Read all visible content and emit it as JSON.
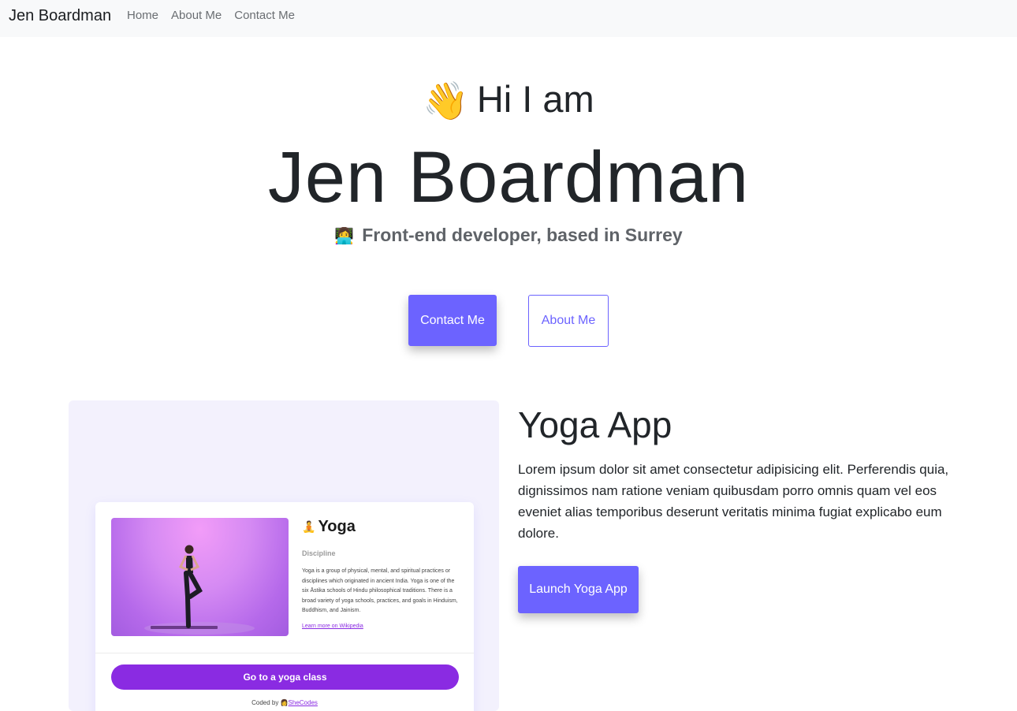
{
  "navbar": {
    "brand": "Jen Boardman",
    "links": [
      "Home",
      "About Me",
      "Contact Me"
    ]
  },
  "hero": {
    "wave_icon": "waving-hand-emoji",
    "wave_glyph": "👋",
    "greeting": "Hi I am",
    "name": "Jen Boardman",
    "dev_icon": "technologist-emoji",
    "dev_glyph": "👩‍💻",
    "subtitle": "Front-end developer, based in Surrey",
    "contact_button": "Contact Me",
    "about_button": "About Me"
  },
  "project": {
    "title": "Yoga App",
    "description": "Lorem ipsum dolor sit amet consectetur adipisicing elit. Perferendis quia, dignissimos nam ratione veniam quibusdam porro omnis quam vel eos eveniet alias temporibus deserunt veritatis minima fugiat explicabo eum dolore.",
    "launch_button": "Launch Yoga App",
    "preview": {
      "title_glyph": "🧘",
      "title": "Yoga",
      "label": "Discipline",
      "text": "Yoga is a group of physical, mental, and spiritual practices or disciplines which originated in ancient India. Yoga is one of the six Āstika schools of Hindu philosophical traditions. There is a broad variety of yoga schools, practices, and goals in Hinduism, Buddhism, and Jainism.",
      "link": "Learn more on Wikipedia",
      "cta": "Go to a yoga class",
      "footer_prefix": "Coded by",
      "footer_glyph": "👩",
      "footer_link": "SheCodes"
    }
  },
  "colors": {
    "accent": "#6c63ff",
    "navbar_bg": "#f8f9fa",
    "preview_bg": "#f3f1fd",
    "preview_cta": "#8a2be2"
  }
}
